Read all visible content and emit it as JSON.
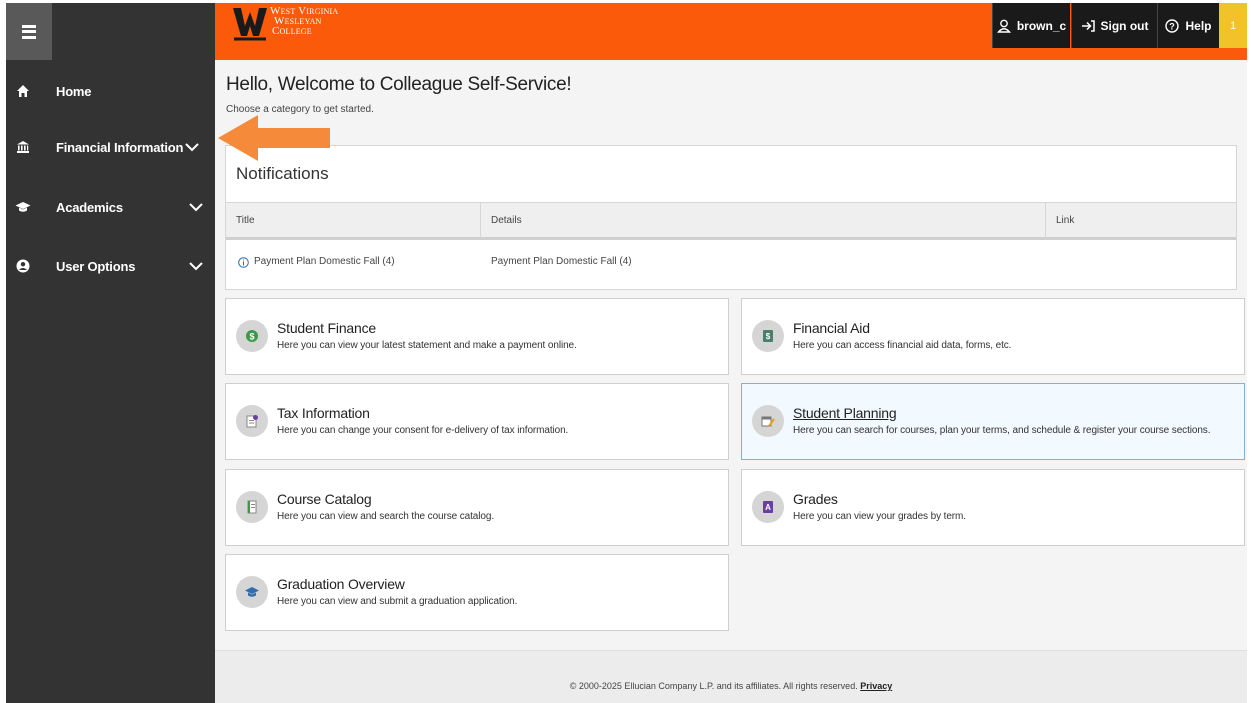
{
  "sidebar": {
    "menu_icon": "hamburger-icon",
    "items": [
      {
        "label": "Home",
        "icon": "home-icon"
      },
      {
        "label": "Financial Information",
        "icon": "bank-icon"
      },
      {
        "label": "Academics",
        "icon": "graduation-cap-icon"
      },
      {
        "label": "User Options",
        "icon": "user-icon"
      }
    ]
  },
  "header": {
    "logo": {
      "line1": "West Virginia",
      "line2": "Wesleyan",
      "line3": "College"
    },
    "user_label": "brown_c",
    "signout_label": "Sign out",
    "help_label": "Help",
    "notification_count": "1",
    "colors": {
      "brand": "#fa5a0a",
      "badge": "#f3c12a"
    }
  },
  "main": {
    "greeting": "Hello, Welcome to Colleague Self-Service!",
    "subgreeting": "Choose a category to get started.",
    "notifications": {
      "title": "Notifications",
      "columns": [
        "Title",
        "Details",
        "Link"
      ],
      "rows": [
        {
          "title": "Payment Plan Domestic Fall (4)",
          "details": "Payment Plan Domestic Fall (4)",
          "link": ""
        }
      ]
    },
    "cards": [
      {
        "title": "Student Finance",
        "desc": "Here you can view your latest statement and make a payment online.",
        "icon": "money-icon"
      },
      {
        "title": "Financial Aid",
        "desc": "Here you can access financial aid data, forms, etc.",
        "icon": "financial-aid-icon"
      },
      {
        "title": "Tax Information",
        "desc": "Here you can change your consent for e-delivery of tax information.",
        "icon": "tax-document-icon"
      },
      {
        "title": "Student Planning",
        "desc": "Here you can search for courses, plan your terms, and schedule & register your course sections.",
        "icon": "planning-icon"
      },
      {
        "title": "Course Catalog",
        "desc": "Here you can view and search the course catalog.",
        "icon": "catalog-book-icon"
      },
      {
        "title": "Grades",
        "desc": "Here you can view your grades by term.",
        "icon": "grades-icon"
      },
      {
        "title": "Graduation Overview",
        "desc": "Here you can view and submit a graduation application.",
        "icon": "graduation-icon"
      }
    ]
  },
  "footer": {
    "text": "© 2000-2025 Ellucian Company L.P. and its affiliates. All rights reserved.",
    "privacy_label": "Privacy"
  }
}
